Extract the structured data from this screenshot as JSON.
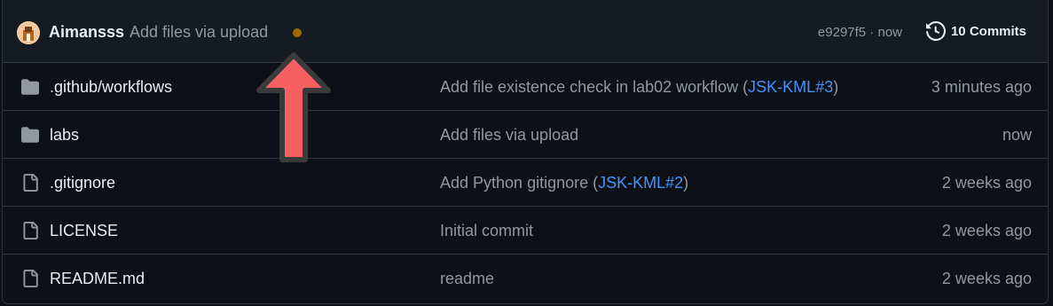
{
  "header": {
    "author": "Aimansss",
    "message": "Add files via upload",
    "status": "pending",
    "sha_time": "e9297f5 · now",
    "commits_label": "10 Commits",
    "status_color": "#9e6a03"
  },
  "files": [
    {
      "type": "folder",
      "name": ".github/workflows",
      "msg_before": "Add file existence check in lab02 workflow (",
      "msg_link": "JSK-KML#3",
      "msg_after": ")",
      "time": "3 minutes ago"
    },
    {
      "type": "folder",
      "name": "labs",
      "msg_before": "Add files via upload",
      "msg_link": "",
      "msg_after": "",
      "time": "now"
    },
    {
      "type": "file",
      "name": ".gitignore",
      "msg_before": "Add Python gitignore (",
      "msg_link": "JSK-KML#2",
      "msg_after": ")",
      "time": "2 weeks ago"
    },
    {
      "type": "file",
      "name": "LICENSE",
      "msg_before": "Initial commit",
      "msg_link": "",
      "msg_after": "",
      "time": "2 weeks ago"
    },
    {
      "type": "file",
      "name": "README.md",
      "msg_before": "readme",
      "msg_link": "",
      "msg_after": "",
      "time": "2 weeks ago"
    }
  ],
  "colors": {
    "background": "#0d1117",
    "header_bg": "#161b22",
    "link": "#4493f8",
    "muted": "#9198a1",
    "annotation_arrow": "#f85f63"
  },
  "icons": {
    "history": "history-icon",
    "folder": "folder-icon",
    "file": "file-icon"
  }
}
